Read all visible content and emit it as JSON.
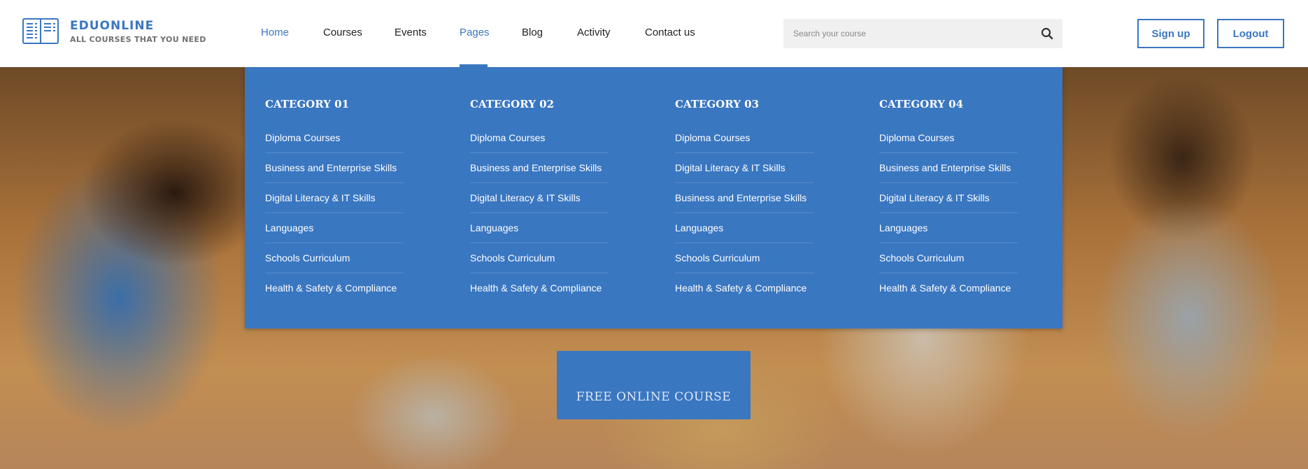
{
  "brand": {
    "name": "EDUONLINE",
    "tagline": "ALL COURSES THAT YOU NEED",
    "icon": "open-book-icon",
    "accent_color": "#3a77c1"
  },
  "nav": {
    "items": [
      {
        "label": "Home",
        "active": true
      },
      {
        "label": "Courses",
        "active": false
      },
      {
        "label": "Events",
        "active": false
      },
      {
        "label": "Pages",
        "active": true,
        "open": true
      },
      {
        "label": "Blog",
        "active": false
      },
      {
        "label": "Activity",
        "active": false
      },
      {
        "label": "Contact us",
        "active": false
      }
    ]
  },
  "search": {
    "placeholder": "Search your course",
    "value": "",
    "icon": "search-icon"
  },
  "actions": {
    "signup_label": "Sign up",
    "logout_label": "Logout"
  },
  "dropdown": {
    "background_color": "#3a77c1",
    "columns": [
      {
        "heading": "CATEGORY 01",
        "items": [
          "Diploma Courses",
          "Business and Enterprise Skills",
          "Digital Literacy & IT Skills",
          "Languages",
          "Schools Curriculum",
          "Health & Safety & Compliance"
        ]
      },
      {
        "heading": "CATEGORY 02",
        "items": [
          "Diploma Courses",
          "Business and Enterprise Skills",
          "Digital Literacy & IT Skills",
          "Languages",
          "Schools Curriculum",
          "Health & Safety & Compliance"
        ]
      },
      {
        "heading": "CATEGORY 03",
        "items": [
          "Diploma Courses",
          "Digital Literacy & IT Skills",
          "Business and Enterprise Skills",
          "Languages",
          "Schools Curriculum",
          "Health & Safety & Compliance"
        ]
      },
      {
        "heading": "CATEGORY 04",
        "items": [
          "Diploma Courses",
          "Business and Enterprise Skills",
          "Digital Literacy & IT Skills",
          "Languages",
          "Schools Curriculum",
          "Health & Safety & Compliance"
        ]
      }
    ]
  },
  "hero": {
    "cta_label": "FREE ONLINE COURSE",
    "image": "students-studying-with-laptop-photo"
  }
}
